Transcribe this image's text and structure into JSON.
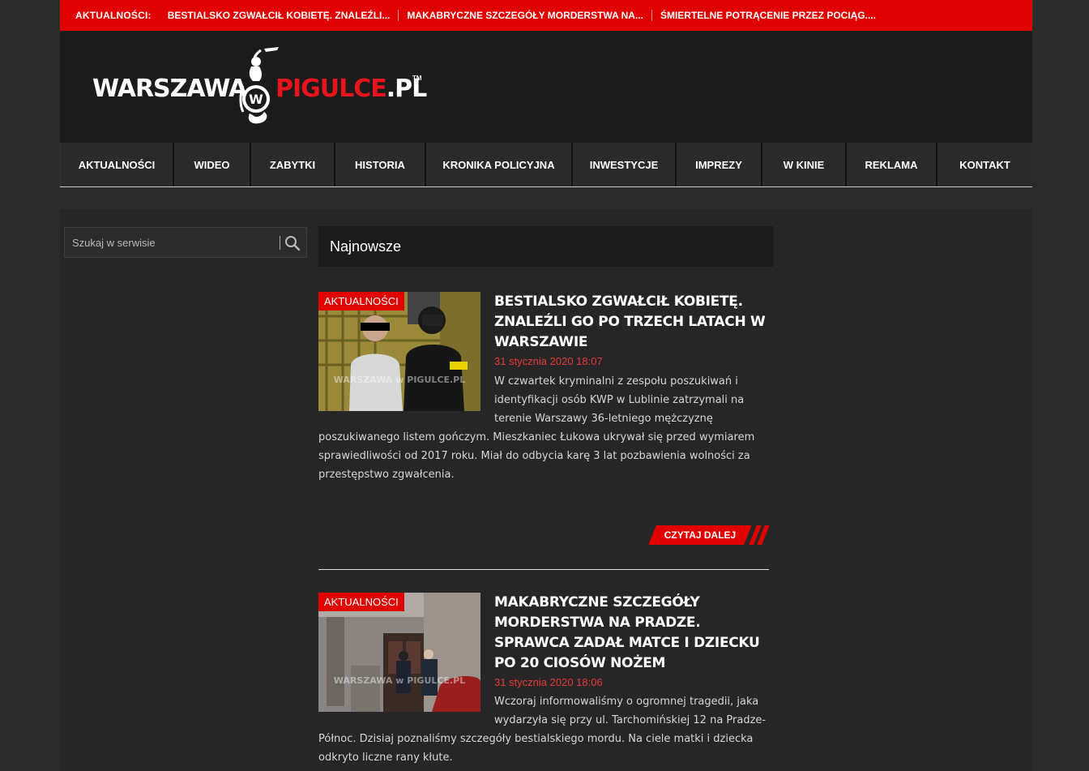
{
  "ticker": {
    "label": "AKTUALNOŚCI:",
    "items": [
      "BESTIALSKO ZGWAŁCIŁ KOBIETĘ. ZNALEŹLI...",
      "MAKABRYCZNE SZCZEGÓŁY MORDERSTWA NA...",
      "ŚMIERTELNE POTRĄCENIE PRZEZ POCIĄG...."
    ]
  },
  "logo": {
    "left": "WARSZAWA",
    "right": "PIGULCE",
    "domain": ".PL",
    "tm": "TM",
    "emblem_letter": "W"
  },
  "nav": {
    "items": [
      "AKTUALNOŚCI",
      "WIDEO",
      "ZABYTKI",
      "HISTORIA",
      "KRONIKA POLICYJNA",
      "INWESTYCJE",
      "IMPREZY",
      "W KINIE",
      "REKLAMA",
      "KONTAKT"
    ]
  },
  "search": {
    "placeholder": "Szukaj w serwisie"
  },
  "section": {
    "title": "Najnowsze"
  },
  "posts": [
    {
      "category": "AKTUALNOŚCI",
      "title": "BESTIALSKO ZGWAŁCIŁ KOBIETĘ. ZNALEŹLI GO PO TRZECH LATACH W WARSZAWIE",
      "date": "31 stycznia 2020 18:07",
      "excerpt": "W czwartek kryminalni z zespołu poszukiwań i identyfikacji osób KWP w Lublinie zatrzymali na terenie Warszawy 36-letniego mężczyznę poszukiwanego listem gończym. Mieszkaniec Łukowa ukrywał się przed wymiarem sprawiedliwości od 2017 roku. Miał do odbycia karę 3 lat pozbawienia wolności za przestępstwo zgwałcenia.",
      "read_more": "CZYTAJ DALEJ",
      "watermark": "WARSZAWA w PIGULCE.PL"
    },
    {
      "category": "AKTUALNOŚCI",
      "title": "MAKABRYCZNE SZCZEGÓŁY MORDERSTWA NA PRADZE. SPRAWCA ZADAŁ MATCE I DZIECKU PO 20 CIOSÓW NOŻEM",
      "date": "31 stycznia 2020 18:06",
      "excerpt": "Wczoraj informowaliśmy o ogromnej tragedii, jaka wydarzyła się przy ul. Tarchomińskiej 12 na Pradze-Północ. Dzisiaj poznaliśmy szczegóły bestialskiego mordu. Na ciele matki i dziecka odkryto liczne rany kłute.",
      "watermark": "WARSZAWA w PIGULCE.PL"
    }
  ],
  "colors": {
    "accent": "#e00000",
    "header_bg": "#1b1b1b",
    "page_bg": "#2b2b2b",
    "date": "#e83a3a"
  }
}
